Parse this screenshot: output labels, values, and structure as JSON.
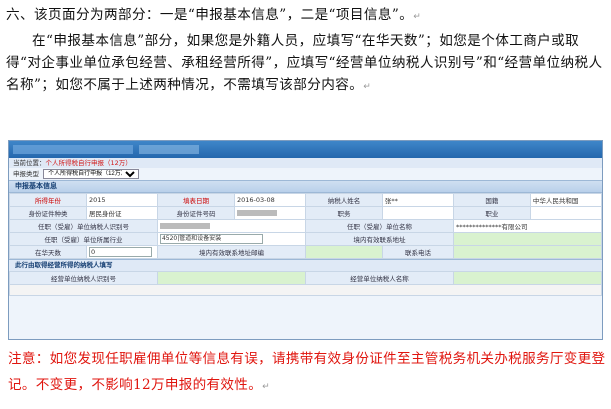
{
  "intro_line": "六、该页面分为两部分：一是“申报基本信息”，二是“项目信息”。",
  "return_mark": "↵",
  "body_paragraph": "在“申报基本信息”部分，如果您是外籍人员，应填写“在华天数”；如您是个体工商户或取得“对企事业单位承包经营、承租经营所得”，应填写“经营单位纳税人识别号”和“经营单位纳税人名称”；如您不属于上述两种情况，不需填写该部分内容。",
  "screenshot": {
    "crumb_prefix": "当前位置：",
    "crumb_item": "个人所得税自行申报（12万）",
    "tax_type_label": "申报类型",
    "tax_type_value": "个人所得税自行申报（12万）",
    "section_title": "申报基本信息",
    "row1": {
      "l1": "所得年份",
      "v1": "2015",
      "l2": "填表日期",
      "v2": "2016-03-08",
      "l3": "纳税人姓名",
      "v3": "张**",
      "l4": "国籍",
      "v4": "中华人民共和国"
    },
    "row2": {
      "l1": "身份证件种类",
      "v1": "居民身份证",
      "l2": "身份证件号码",
      "l3": "职务",
      "l4": "职业"
    },
    "row3": {
      "l1": "任职（受雇）单位纳税人识别号",
      "l2": "任职（受雇）单位名称",
      "v2": "**************有限公司"
    },
    "row4": {
      "l1": "任职（受雇）单位所属行业",
      "v1": "4520|管道和设备安装",
      "l2": "境内有效联系地址"
    },
    "row5": {
      "l1": "在华天数",
      "v1": "0",
      "l2": "境内有效联系地址邮编",
      "l3": "联系电话"
    },
    "section2_title": "此行由取得经营所得的纳税人填写",
    "row6": {
      "l1": "经营单位纳税人识别号",
      "l2": "经营单位纳税人名称"
    }
  },
  "notice": "注意：如您发现任职雇佣单位等信息有误，请携带有效身份证件至主管税务机关办税服务厅变更登记。不变更，不影响12万申报的有效性。"
}
